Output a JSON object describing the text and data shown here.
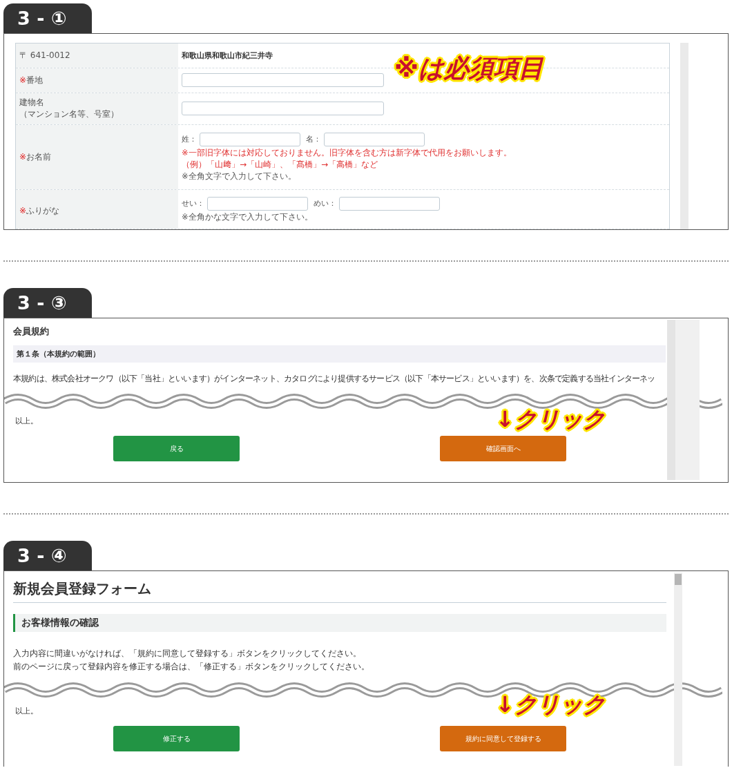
{
  "section_1": {
    "tab": "3 - ①",
    "callout": "※は必須項目",
    "rows": [
      {
        "kind": "static",
        "label_lines": [
          "〒 641-0012"
        ],
        "value": "和歌山県和歌山市紀三井寺"
      },
      {
        "kind": "input",
        "mark": "※",
        "label_lines": [
          "番地"
        ]
      },
      {
        "kind": "input",
        "label_lines": [
          "建物名",
          "（マンション名等、号室）"
        ]
      },
      {
        "kind": "split",
        "mark": "※",
        "label_lines": [
          "お名前"
        ],
        "fields": [
          {
            "label": "姓："
          },
          {
            "label": "名："
          }
        ],
        "notes": [
          {
            "kind": "warning",
            "text": "※一部旧字体には対応しておりません。旧字体を含む方は新字体で代用をお願いします。"
          },
          {
            "kind": "example",
            "text": "（例）「山﨑」→「山崎」、「髙橋」→「高橋」など"
          },
          {
            "kind": "plain",
            "text": "※全角文字で入力して下さい。"
          }
        ]
      },
      {
        "kind": "split",
        "mark": "※",
        "label_lines": [
          "ふりがな"
        ],
        "fields": [
          {
            "label": "せい："
          },
          {
            "label": "めい："
          }
        ],
        "notes": [
          {
            "kind": "plain",
            "text": "※全角かな文字で入力して下さい。"
          }
        ]
      }
    ]
  },
  "section_3": {
    "tab": "3 - ③",
    "heading": "会員規約",
    "article": "第１条（本規約の範囲）",
    "paragraph": "本規約は、株式会社オークワ（以下「当社」といいます）がインターネット、カタログにより提供するサービス（以下「本サービス」といいます）を、次条で定義する当社インターネッ",
    "closing": "以上。",
    "callout": "↓クリック",
    "buttons": [
      {
        "kind": "back",
        "label": "戻る"
      },
      {
        "kind": "next",
        "label": "確認画面へ"
      }
    ]
  },
  "section_4": {
    "tab": "3 - ④",
    "title": "新規会員登録フォーム",
    "heading": "お客様情報の確認",
    "paragraphs": [
      "入力内容に間違いがなければ、「規約に同意して登録する」ボタンをクリックしてください。",
      "前のページに戻って登録内容を修正する場合は、「修正する」ボタンをクリックしてください。"
    ],
    "closing": "以上。",
    "callout": "↓クリック",
    "buttons": [
      {
        "kind": "back",
        "label": "修正する"
      },
      {
        "kind": "next",
        "label": "規約に同意して登録する"
      }
    ]
  }
}
